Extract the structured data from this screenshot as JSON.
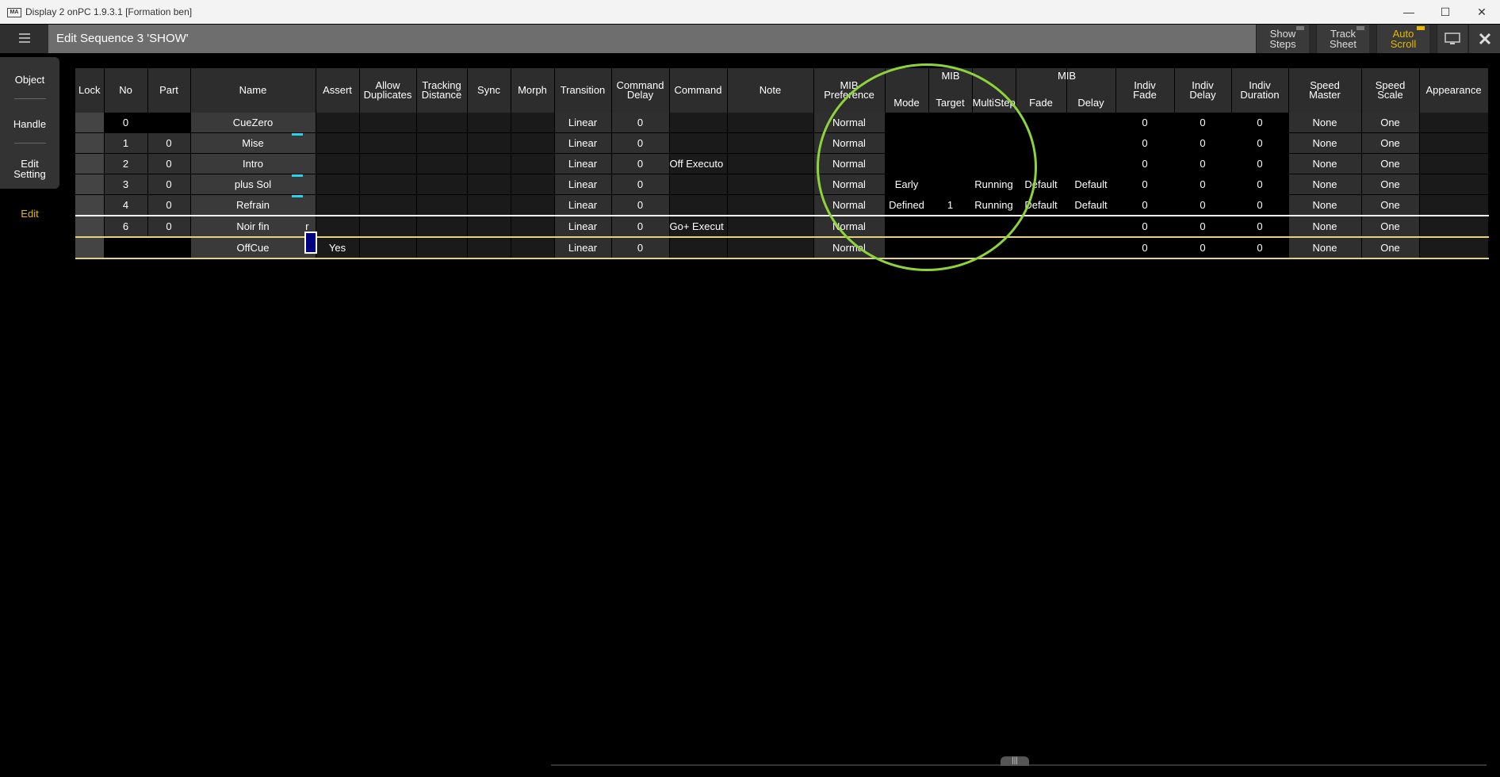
{
  "window": {
    "title": "Display 2 onPC 1.9.3.1 [Formation ben]",
    "app_icon": "MA"
  },
  "window_controls": {
    "minimize": "—",
    "maximize": "☐",
    "close": "✕"
  },
  "toolbar": {
    "title": "Edit Sequence 3 'SHOW'",
    "show_steps": "Show\nSteps",
    "track_sheet": "Track\nSheet",
    "auto_scroll": "Auto\nScroll",
    "auto_scroll_color": "#e6b800"
  },
  "left_panel": {
    "object": "Object",
    "handle": "Handle",
    "edit_setting": "Edit\nSetting",
    "edit": "Edit"
  },
  "headers": {
    "lock": "Lock",
    "no": "No",
    "part": "Part",
    "name": "Name",
    "assert": "Assert",
    "allow_duplicates": "Allow\nDuplicates",
    "tracking_distance": "Tracking\nDistance",
    "sync": "Sync",
    "morph": "Morph",
    "transition": "Transition",
    "command_delay": "Command\nDelay",
    "command": "Command",
    "note": "Note",
    "mib_preference": "MIB\nPreference",
    "mib_group1": "MIB",
    "mode": "Mode",
    "target": "Target",
    "multistep": "MultiStep",
    "mib_group2": "MIB",
    "fade": "Fade",
    "delay": "Delay",
    "indiv_fade": "Indiv\nFade",
    "indiv_delay": "Indiv\nDelay",
    "indiv_duration": "Indiv\nDuration",
    "speed_master": "Speed\nMaster",
    "speed_scale": "Speed\nScale",
    "appearance": "Appearance"
  },
  "rows": [
    {
      "no": "0",
      "part": "",
      "name": "CueZero",
      "transition": "Linear",
      "cmd_delay": "0",
      "command": "",
      "mib_pref": "Normal",
      "mode": "",
      "target": "",
      "multistep": "",
      "fade": "",
      "delay": "",
      "indiv_fade": "0",
      "indiv_delay": "0",
      "indiv_duration": "0",
      "speed_master": "None",
      "speed_scale": "One"
    },
    {
      "no": "1",
      "part": "0",
      "name": "Mise",
      "transition": "Linear",
      "cmd_delay": "0",
      "command": "",
      "mib_pref": "Normal",
      "mode": "",
      "target": "",
      "multistep": "",
      "fade": "",
      "delay": "",
      "indiv_fade": "0",
      "indiv_delay": "0",
      "indiv_duration": "0",
      "speed_master": "None",
      "speed_scale": "One"
    },
    {
      "no": "2",
      "part": "0",
      "name": "Intro",
      "transition": "Linear",
      "cmd_delay": "0",
      "command": "Off  Executo",
      "mib_pref": "Normal",
      "mode": "",
      "target": "",
      "multistep": "",
      "fade": "",
      "delay": "",
      "indiv_fade": "0",
      "indiv_delay": "0",
      "indiv_duration": "0",
      "speed_master": "None",
      "speed_scale": "One"
    },
    {
      "no": "3",
      "part": "0",
      "name": "plus  Sol",
      "transition": "Linear",
      "cmd_delay": "0",
      "command": "",
      "mib_pref": "Normal",
      "mode": "Early",
      "target": "",
      "multistep": "Running",
      "fade": "Default",
      "delay": "Default",
      "indiv_fade": "0",
      "indiv_delay": "0",
      "indiv_duration": "0",
      "speed_master": "None",
      "speed_scale": "One"
    },
    {
      "no": "4",
      "part": "0",
      "name": "Refrain",
      "transition": "Linear",
      "cmd_delay": "0",
      "command": "",
      "mib_pref": "Normal",
      "mode": "Defined",
      "target": "1",
      "multistep": "Running",
      "fade": "Default",
      "delay": "Default",
      "indiv_fade": "0",
      "indiv_delay": "0",
      "indiv_duration": "0",
      "speed_master": "None",
      "speed_scale": "One"
    },
    {
      "no": "6",
      "part": "0",
      "name": "Noir  fin",
      "name_extra": "r",
      "transition": "Linear",
      "cmd_delay": "0",
      "command": "Go+  Execut",
      "mib_pref": "Normal",
      "mode": "",
      "target": "",
      "multistep": "",
      "fade": "",
      "delay": "",
      "indiv_fade": "0",
      "indiv_delay": "0",
      "indiv_duration": "0",
      "speed_master": "None",
      "speed_scale": "One"
    },
    {
      "no": "",
      "part": "",
      "name": "OffCue",
      "assert": "Yes",
      "transition": "Linear",
      "cmd_delay": "0",
      "command": "",
      "mib_pref": "Normal",
      "mode": "",
      "target": "",
      "multistep": "",
      "fade": "",
      "delay": "",
      "indiv_fade": "0",
      "indiv_delay": "0",
      "indiv_duration": "0",
      "speed_master": "None",
      "speed_scale": "One"
    }
  ],
  "scroll_handle": "|||",
  "highlight_color": "#8fd33c"
}
